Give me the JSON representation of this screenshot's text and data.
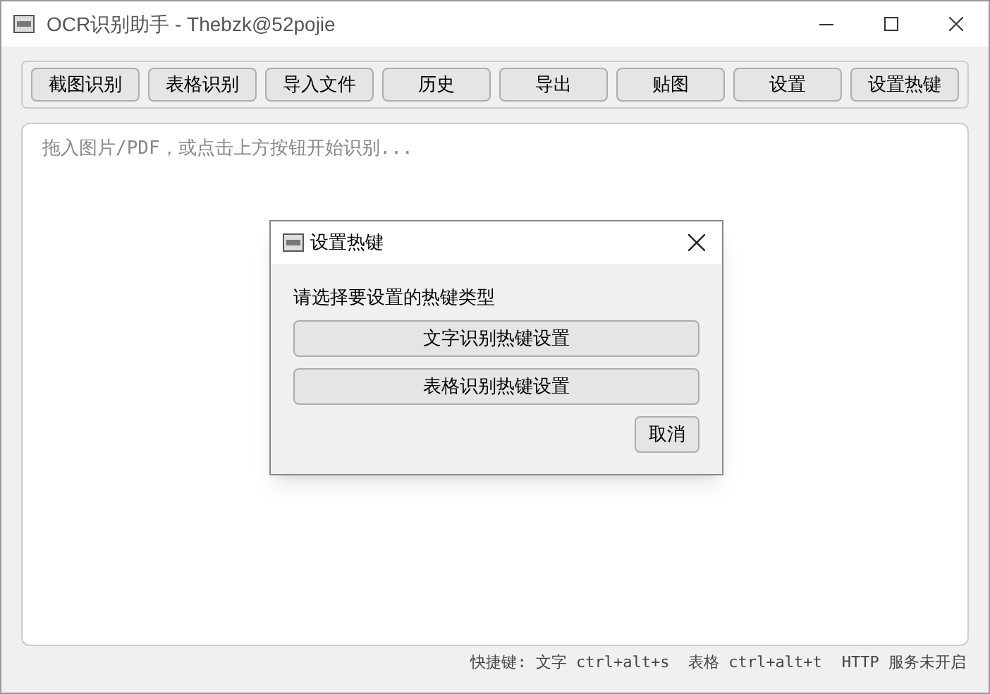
{
  "window": {
    "title": "OCR识别助手 - Thebzk@52pojie"
  },
  "toolbar": [
    "截图识别",
    "表格识别",
    "导入文件",
    "历史",
    "导出",
    "贴图",
    "设置",
    "设置热键"
  ],
  "text_area": {
    "placeholder": "拖入图片/PDF，或点击上方按钮开始识别..."
  },
  "dialog": {
    "title": "设置热键",
    "prompt": "请选择要设置的热键类型",
    "options": [
      "文字识别热键设置",
      "表格识别热键设置"
    ],
    "cancel": "取消"
  },
  "status_bar": {
    "hotkeys": "快捷键: 文字 ctrl+alt+s  表格 ctrl+alt+t",
    "http": "HTTP 服务未开启"
  }
}
